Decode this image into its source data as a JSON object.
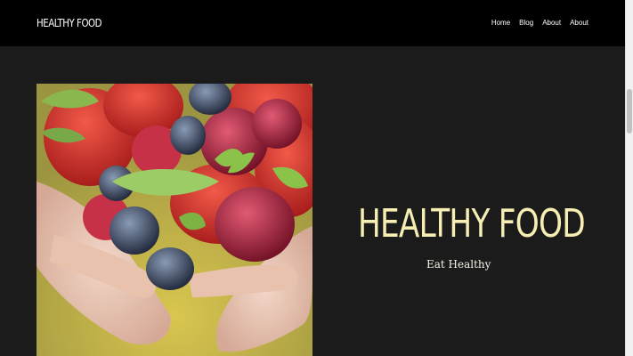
{
  "header": {
    "brand": "HEALTHY FOOD",
    "nav": [
      "Home",
      "Blog",
      "About",
      "About"
    ]
  },
  "hero": {
    "title": "HEALTHY FOOD",
    "subtitle": "Eat Healthy",
    "image_alt": "Hands holding strawberries, blueberries, cherries and raspberries"
  },
  "colors": {
    "header_bg": "#000000",
    "page_bg": "#1b1b1b",
    "title": "#f6eeb3",
    "text": "#ffffff"
  }
}
